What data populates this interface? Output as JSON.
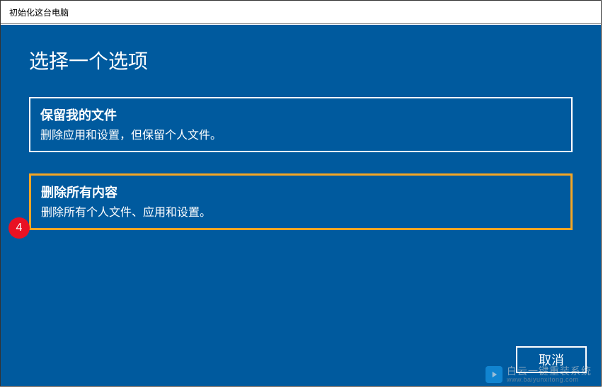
{
  "window": {
    "title": "初始化这台电脑"
  },
  "heading": "选择一个选项",
  "options": [
    {
      "title": "保留我的文件",
      "description": "删除应用和设置，但保留个人文件。"
    },
    {
      "title": "删除所有内容",
      "description": "删除所有个人文件、应用和设置。"
    }
  ],
  "step_badge": "4",
  "cancel_label": "取消",
  "watermark": {
    "main": "白云一键重装系统",
    "sub": "www.baiyunxitong.com"
  }
}
